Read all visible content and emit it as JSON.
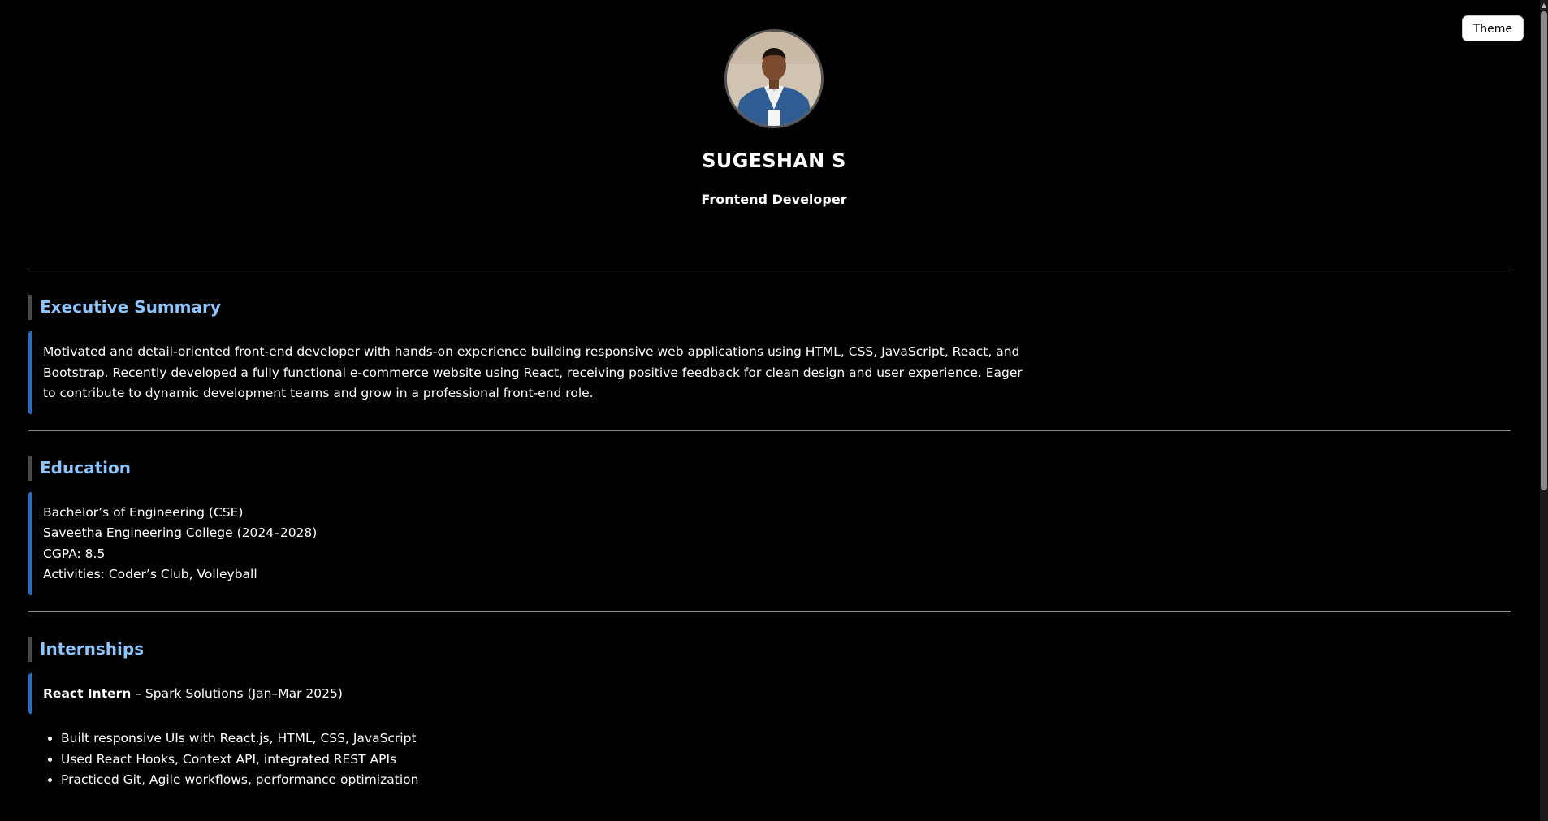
{
  "theme_button": {
    "label": "Theme"
  },
  "profile": {
    "name": "SUGESHAN S",
    "role": "Frontend Developer"
  },
  "sections": {
    "summary": {
      "title": "Executive Summary",
      "text": "Motivated and detail-oriented front-end developer with hands-on experience building responsive web applications using HTML, CSS, JavaScript, React, and Bootstrap. Recently developed a fully functional e-commerce website using React, receiving positive feedback for clean design and user experience. Eager to contribute to dynamic development teams and grow in a professional front-end role."
    },
    "education": {
      "title": "Education",
      "lines": [
        "Bachelor’s of Engineering (CSE)",
        "Saveetha Engineering College (2024–2028)",
        "CGPA: 8.5",
        "Activities: Coder’s Club, Volleyball"
      ]
    },
    "internships": {
      "title": "Internships",
      "position": "React Intern",
      "company": " – Spark Solutions (Jan–Mar 2025)",
      "bullets": [
        "Built responsive UIs with React.js, HTML, CSS, JavaScript",
        "Used React Hooks, Context API, integrated REST APIs",
        "Practiced Git, Agile workflows, performance optimization"
      ]
    }
  },
  "colors": {
    "background": "#000000",
    "section_title": "#8ec5ff",
    "card_accent": "#1f6fd1",
    "divider": "#8a8a8a"
  }
}
